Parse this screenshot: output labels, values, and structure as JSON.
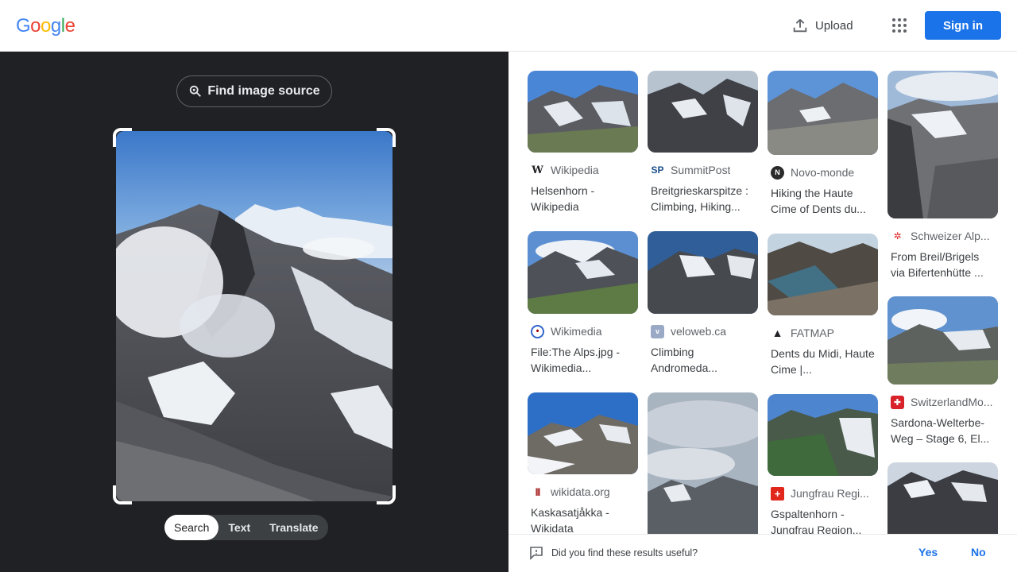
{
  "header": {
    "logo": [
      "G",
      "o",
      "o",
      "g",
      "l",
      "e"
    ],
    "upload_label": "Upload",
    "signin_label": "Sign in"
  },
  "left": {
    "find_source_label": "Find image source",
    "tabs": [
      "Search",
      "Text",
      "Translate"
    ],
    "active_tab": "Search"
  },
  "results": [
    {
      "source": "Wikipedia",
      "title": "Helsenhorn - Wikipedia",
      "icon": "wikipedia-icon"
    },
    {
      "source": "SummitPost",
      "title": "Breitgrieskarspitze : Climbing, Hiking...",
      "icon": "summitpost-icon"
    },
    {
      "source": "Novo-monde",
      "title": "Hiking the Haute Cime of Dents du...",
      "icon": "novo-monde-icon"
    },
    {
      "source": "Schweizer Alp...",
      "title": "From Breil/Brigels via Bifertenhütte ...",
      "icon": "sac-icon"
    },
    {
      "source": "Wikimedia",
      "title": "File:The Alps.jpg - Wikimedia...",
      "icon": "wikimedia-icon"
    },
    {
      "source": "veloweb.ca",
      "title": "Climbing Andromeda...",
      "icon": "veloweb-icon"
    },
    {
      "source": "FATMAP",
      "title": "Dents du Midi, Haute Cime |...",
      "icon": "fatmap-icon"
    },
    {
      "source": "SwitzerlandMo...",
      "title": "Sardona-Welterbe-Weg – Stage 6, El...",
      "icon": "switzerland-icon"
    },
    {
      "source": "wikidata.org",
      "title": "Kaskasatjåkka - Wikidata",
      "icon": "wikidata-icon"
    },
    {
      "source": "Jungfrau Regi...",
      "title": "Gspaltenhorn - Jungfrau Region...",
      "icon": "jungfrau-icon"
    }
  ],
  "feedback": {
    "question": "Did you find these results useful?",
    "yes": "Yes",
    "no": "No"
  },
  "colors": {
    "accent": "#1a73e8",
    "dark_panel": "#202124"
  }
}
